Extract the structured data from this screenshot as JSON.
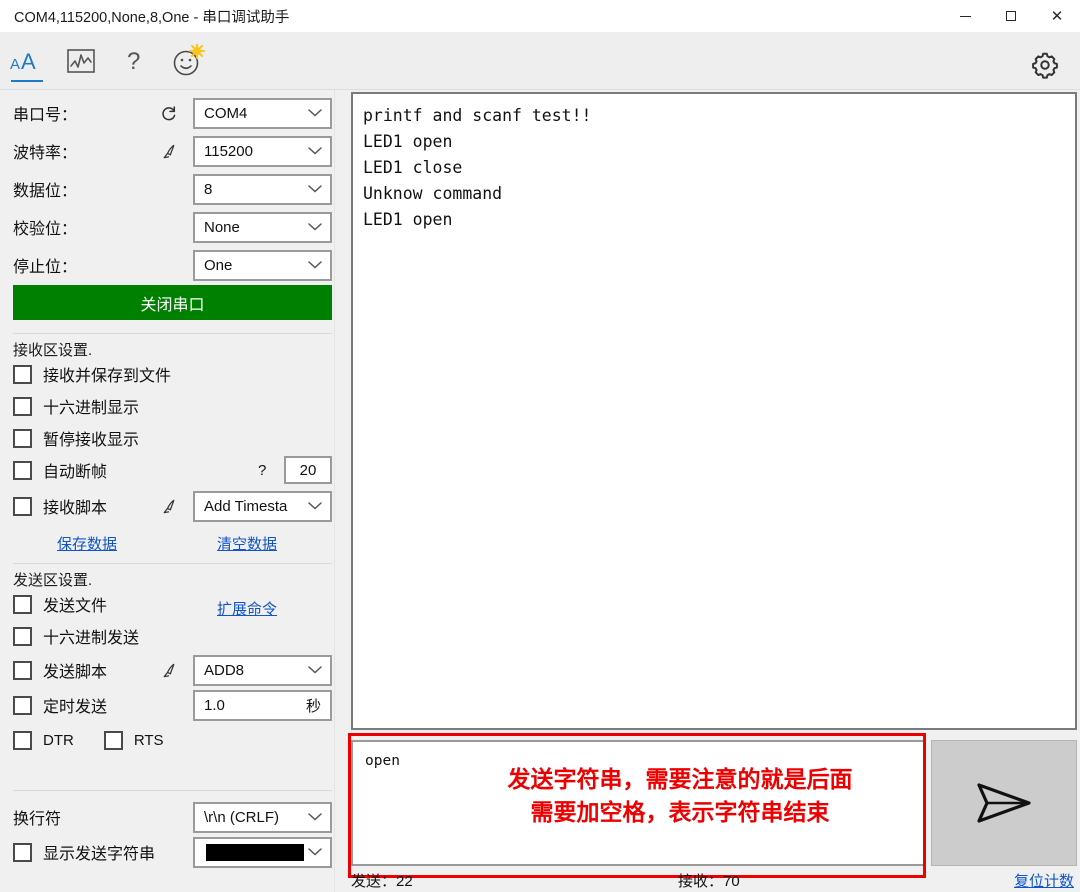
{
  "window": {
    "title": "COM4,115200,None,8,One - 串口调试助手",
    "minimize_label": "最小化",
    "maximize_label": "最大化",
    "close_label": "关闭"
  },
  "toolbar": {
    "items": [
      {
        "name": "font-size-icon",
        "label": "AA",
        "active": true
      },
      {
        "name": "waveform-icon",
        "label": "波形",
        "active": false
      },
      {
        "name": "help-icon",
        "label": "?",
        "active": false
      },
      {
        "name": "smiley-icon",
        "label": "☺",
        "active": false
      }
    ],
    "settings_label": "设置"
  },
  "sidebar": {
    "port_settings": [
      {
        "label": "串口号：",
        "value": "COM4",
        "icon": "refresh-icon"
      },
      {
        "label": "波特率：",
        "value": "115200",
        "icon": "pen-icon"
      },
      {
        "label": "数据位：",
        "value": "8",
        "icon": ""
      },
      {
        "label": "校验位：",
        "value": "None",
        "icon": ""
      },
      {
        "label": "停止位：",
        "value": "One",
        "icon": ""
      }
    ],
    "connect_button": "关闭串口",
    "recv_section": {
      "title": "接收区设置.",
      "checkboxes": [
        {
          "label": "接收并保存到文件",
          "checked": false
        },
        {
          "label": "十六进制显示",
          "checked": false
        },
        {
          "label": "暂停接收显示",
          "checked": false
        },
        {
          "label": "自动断帧",
          "checked": false
        },
        {
          "label": "接收脚本",
          "checked": false
        }
      ],
      "auto_break_help": "?",
      "auto_break_value": "20",
      "script_select": "Add Timesta",
      "script_icon": "pen-icon",
      "save_link": "保存数据",
      "clear_link": "清空数据"
    },
    "send_section": {
      "title": "发送区设置.",
      "checkboxes": [
        {
          "label": "发送文件",
          "checked": false
        },
        {
          "label": "十六进制发送",
          "checked": false
        },
        {
          "label": "发送脚本",
          "checked": false
        },
        {
          "label": "定时发送",
          "checked": false
        }
      ],
      "extend_link": "扩展命令",
      "script_select": "ADD8",
      "script_icon": "pen-icon",
      "interval_value": "1.0",
      "interval_unit": "秒",
      "dtr_label": "DTR",
      "rts_label": "RTS",
      "dtr_checked": false,
      "rts_checked": false
    },
    "line_ending": {
      "label": "换行符",
      "value": "\\r\\n (CRLF)"
    },
    "show_sent": {
      "label": "显示发送字符串",
      "checked": false,
      "color_value": "#000000"
    }
  },
  "receive_panel": {
    "text": "printf and scanf test!!\nLED1 open\nLED1 close\nUnknow command\nLED1 open"
  },
  "send_panel": {
    "value": "open",
    "placeholder": "",
    "send_button_icon": "send-arrow-icon"
  },
  "annotation": {
    "text": "发送字符串，需要注意的就是后面\n需要加空格，表示字符串结束",
    "color": "#ee0000"
  },
  "statusbar": {
    "sent": "发送：22",
    "received": "接收：70",
    "reset_link": "复位计数"
  },
  "colors": {
    "accent": "#1f7ac6",
    "connect_green": "#008000",
    "link": "#1155cc",
    "annotation_red": "#ee0000",
    "toolbar_bg": "#eeeeee",
    "sidebar_bg": "#f0f0f0"
  }
}
